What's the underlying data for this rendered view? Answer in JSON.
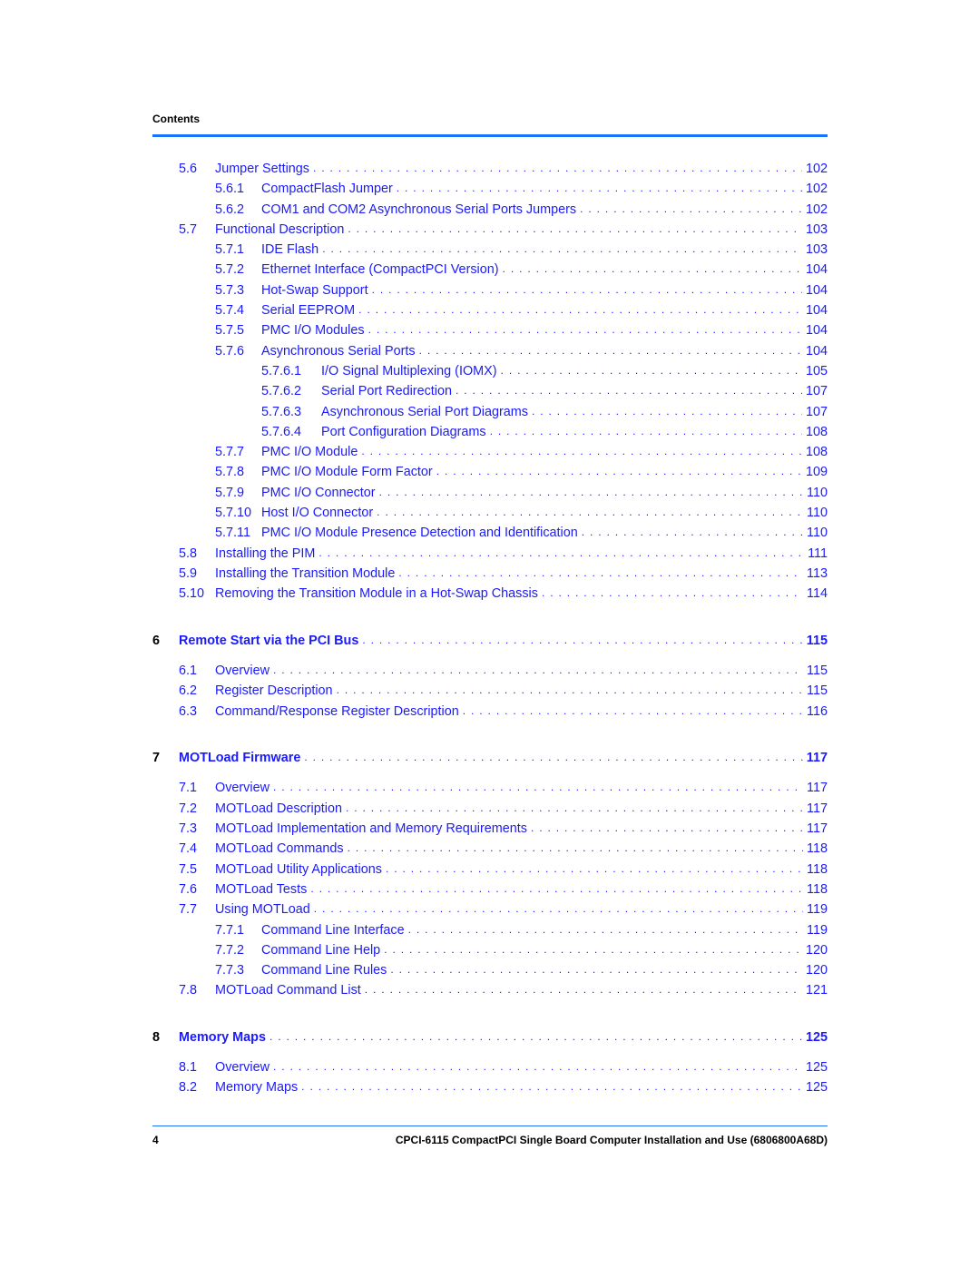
{
  "header": {
    "title": "Contents"
  },
  "toc": [
    {
      "level": 2,
      "num": "5.6",
      "title": "Jumper Settings",
      "page": "102"
    },
    {
      "level": 3,
      "num": "5.6.1",
      "title": "CompactFlash Jumper",
      "page": "102"
    },
    {
      "level": 3,
      "num": "5.6.2",
      "title": "COM1 and COM2 Asynchronous Serial Ports Jumpers",
      "page": "102"
    },
    {
      "level": 2,
      "num": "5.7",
      "title": "Functional Description",
      "page": "103"
    },
    {
      "level": 3,
      "num": "5.7.1",
      "title": "IDE Flash",
      "page": "103"
    },
    {
      "level": 3,
      "num": "5.7.2",
      "title": "Ethernet Interface (CompactPCI Version)",
      "page": "104"
    },
    {
      "level": 3,
      "num": "5.7.3",
      "title": "Hot-Swap Support",
      "page": "104"
    },
    {
      "level": 3,
      "num": "5.7.4",
      "title": "Serial EEPROM",
      "page": "104"
    },
    {
      "level": 3,
      "num": "5.7.5",
      "title": "PMC I/O Modules",
      "page": "104"
    },
    {
      "level": 3,
      "num": "5.7.6",
      "title": "Asynchronous Serial Ports",
      "page": "104"
    },
    {
      "level": 4,
      "num": "5.7.6.1",
      "title": "I/O Signal Multiplexing (IOMX)",
      "page": "105"
    },
    {
      "level": 4,
      "num": "5.7.6.2",
      "title": "Serial Port Redirection",
      "page": "107"
    },
    {
      "level": 4,
      "num": "5.7.6.3",
      "title": "Asynchronous Serial Port Diagrams",
      "page": "107"
    },
    {
      "level": 4,
      "num": "5.7.6.4",
      "title": "Port Configuration Diagrams",
      "page": "108"
    },
    {
      "level": 3,
      "num": "5.7.7",
      "title": "PMC I/O Module",
      "page": "108"
    },
    {
      "level": 3,
      "num": "5.7.8",
      "title": "PMC I/O Module Form Factor",
      "page": "109"
    },
    {
      "level": 3,
      "num": "5.7.9",
      "title": "PMC I/O Connector",
      "page": "110"
    },
    {
      "level": 3,
      "num": "5.7.10",
      "title": "Host I/O Connector",
      "page": "110"
    },
    {
      "level": 3,
      "num": "5.7.11",
      "title": "PMC I/O Module Presence Detection and Identification",
      "page": "110"
    },
    {
      "level": 2,
      "num": "5.8",
      "title": "Installing the PIM",
      "page": "111"
    },
    {
      "level": 2,
      "num": "5.9",
      "title": "Installing the Transition Module",
      "page": "113"
    },
    {
      "level": 2,
      "num": "5.10",
      "title": "Removing the Transition Module in a Hot-Swap Chassis",
      "page": "114"
    },
    {
      "level": 1,
      "num": "6",
      "title": "Remote Start via the PCI Bus",
      "page": "115"
    },
    {
      "level": 2,
      "num": "6.1",
      "title": "Overview",
      "page": "115"
    },
    {
      "level": 2,
      "num": "6.2",
      "title": "Register Description",
      "page": "115"
    },
    {
      "level": 2,
      "num": "6.3",
      "title": "Command/Response Register Description",
      "page": "116"
    },
    {
      "level": 1,
      "num": "7",
      "title": "MOTLoad Firmware",
      "page": "117"
    },
    {
      "level": 2,
      "num": "7.1",
      "title": "Overview",
      "page": "117"
    },
    {
      "level": 2,
      "num": "7.2",
      "title": "MOTLoad Description",
      "page": "117"
    },
    {
      "level": 2,
      "num": "7.3",
      "title": "MOTLoad Implementation and Memory Requirements",
      "page": "117"
    },
    {
      "level": 2,
      "num": "7.4",
      "title": "MOTLoad Commands",
      "page": "118"
    },
    {
      "level": 2,
      "num": "7.5",
      "title": "MOTLoad Utility Applications",
      "page": "118"
    },
    {
      "level": 2,
      "num": "7.6",
      "title": "MOTLoad Tests",
      "page": "118"
    },
    {
      "level": 2,
      "num": "7.7",
      "title": "Using MOTLoad",
      "page": "119"
    },
    {
      "level": 3,
      "num": "7.7.1",
      "title": "Command Line Interface",
      "page": "119"
    },
    {
      "level": 3,
      "num": "7.7.2",
      "title": "Command Line Help",
      "page": "120"
    },
    {
      "level": 3,
      "num": "7.7.3",
      "title": "Command Line Rules",
      "page": "120"
    },
    {
      "level": 2,
      "num": "7.8",
      "title": "MOTLoad Command List",
      "page": "121"
    },
    {
      "level": 1,
      "num": "8",
      "title": "Memory Maps",
      "page": "125"
    },
    {
      "level": 2,
      "num": "8.1",
      "title": "Overview",
      "page": "125"
    },
    {
      "level": 2,
      "num": "8.2",
      "title": "Memory Maps",
      "page": "125"
    }
  ],
  "footer": {
    "page_number": "4",
    "document_title": "CPCI-6115 CompactPCI Single Board Computer Installation and Use (6806800A68D)"
  },
  "colors": {
    "link": "#1a1aff",
    "rule": "#1a73ff",
    "text": "#000000"
  }
}
